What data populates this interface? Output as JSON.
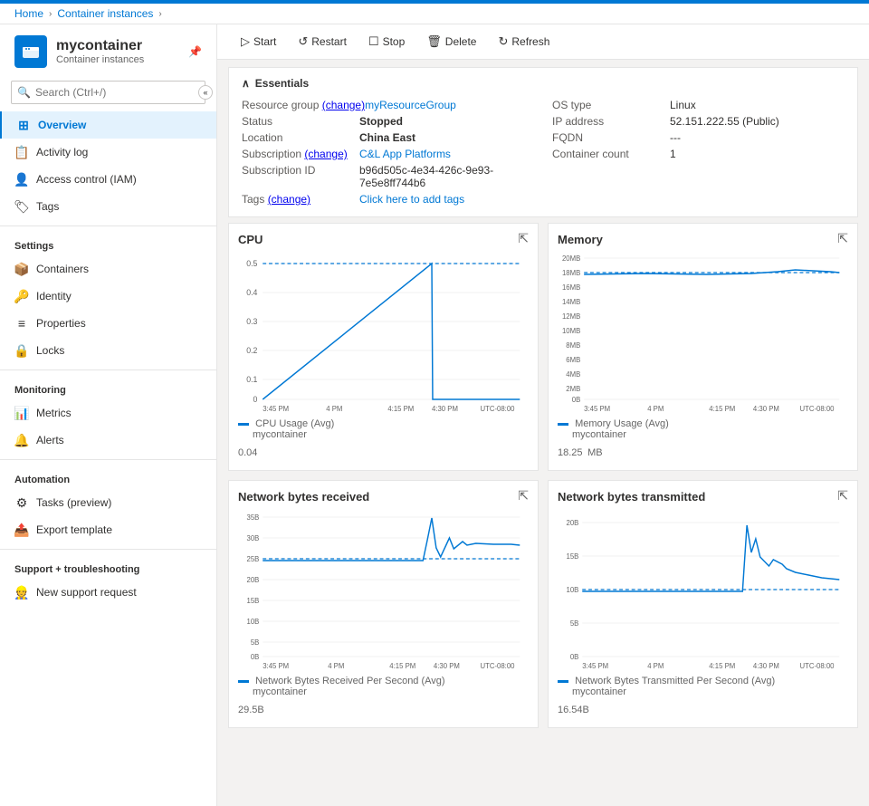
{
  "topBar": {
    "breadcrumbs": [
      "Home",
      "Container instances"
    ]
  },
  "sidebar": {
    "title": "mycontainer",
    "subtitle": "Container instances",
    "searchPlaceholder": "Search (Ctrl+/)",
    "nav": [
      {
        "id": "overview",
        "label": "Overview",
        "icon": "⊞",
        "active": true,
        "section": null
      },
      {
        "id": "activity-log",
        "label": "Activity log",
        "icon": "📋",
        "active": false,
        "section": null
      },
      {
        "id": "access-control",
        "label": "Access control (IAM)",
        "icon": "👤",
        "active": false,
        "section": null
      },
      {
        "id": "tags",
        "label": "Tags",
        "icon": "🏷",
        "active": false,
        "section": null
      },
      {
        "id": "settings-header",
        "label": "Settings",
        "section": true
      },
      {
        "id": "containers",
        "label": "Containers",
        "icon": "📦",
        "active": false,
        "section": false
      },
      {
        "id": "identity",
        "label": "Identity",
        "icon": "🔑",
        "active": false,
        "section": false
      },
      {
        "id": "properties",
        "label": "Properties",
        "icon": "≡",
        "active": false,
        "section": false
      },
      {
        "id": "locks",
        "label": "Locks",
        "icon": "🔒",
        "active": false,
        "section": false
      },
      {
        "id": "monitoring-header",
        "label": "Monitoring",
        "section": true
      },
      {
        "id": "metrics",
        "label": "Metrics",
        "icon": "📊",
        "active": false,
        "section": false
      },
      {
        "id": "alerts",
        "label": "Alerts",
        "icon": "🔔",
        "active": false,
        "section": false
      },
      {
        "id": "automation-header",
        "label": "Automation",
        "section": true
      },
      {
        "id": "tasks",
        "label": "Tasks (preview)",
        "icon": "⚙",
        "active": false,
        "section": false
      },
      {
        "id": "export-template",
        "label": "Export template",
        "icon": "📤",
        "active": false,
        "section": false
      },
      {
        "id": "support-header",
        "label": "Support + troubleshooting",
        "section": true
      },
      {
        "id": "new-support",
        "label": "New support request",
        "icon": "👷",
        "active": false,
        "section": false
      }
    ]
  },
  "toolbar": {
    "buttons": [
      {
        "id": "start",
        "label": "Start",
        "icon": "▷"
      },
      {
        "id": "restart",
        "label": "Restart",
        "icon": "↺"
      },
      {
        "id": "stop",
        "label": "Stop",
        "icon": "☐"
      },
      {
        "id": "delete",
        "label": "Delete",
        "icon": "🗑"
      },
      {
        "id": "refresh",
        "label": "Refresh",
        "icon": "↻"
      }
    ]
  },
  "essentials": {
    "header": "Essentials",
    "leftFields": [
      {
        "label": "Resource group (change)",
        "value": "myResourceGroup",
        "link": true
      },
      {
        "label": "Status",
        "value": "Stopped",
        "bold": true
      },
      {
        "label": "Location",
        "value": "China East",
        "bold": true
      },
      {
        "label": "Subscription (change)",
        "value": "C&L App Platforms",
        "link": true
      },
      {
        "label": "Subscription ID",
        "value": "b96d505c-4e34-426c-9e93-7e5e8ff744b6"
      },
      {
        "label": "Tags (change)",
        "value": "Click here to add tags",
        "link": true
      }
    ],
    "rightFields": [
      {
        "label": "OS type",
        "value": "Linux"
      },
      {
        "label": "IP address",
        "value": "52.151.222.55 (Public)"
      },
      {
        "label": "FQDN",
        "value": "---"
      },
      {
        "label": "Container count",
        "value": "1"
      }
    ]
  },
  "charts": {
    "cpu": {
      "title": "CPU",
      "legendLabel": "CPU Usage (Avg)",
      "legendSub": "mycontainer",
      "value": "0.04",
      "unit": "",
      "xLabels": [
        "3:45 PM",
        "4 PM",
        "4:15 PM",
        "4:30 PM",
        "UTC-08:00"
      ],
      "yLabels": [
        "0.5",
        "0.4",
        "0.3",
        "0.2",
        "0.1",
        "0"
      ],
      "color": "#0078d4"
    },
    "memory": {
      "title": "Memory",
      "legendLabel": "Memory Usage (Avg)",
      "legendSub": "mycontainer",
      "value": "18.25",
      "unit": "MB",
      "xLabels": [
        "3:45 PM",
        "4 PM",
        "4:15 PM",
        "4:30 PM",
        "UTC-08:00"
      ],
      "yLabels": [
        "20MB",
        "18MB",
        "16MB",
        "14MB",
        "12MB",
        "10MB",
        "8MB",
        "6MB",
        "4MB",
        "2MB",
        "0B"
      ],
      "color": "#0078d4"
    },
    "netReceived": {
      "title": "Network bytes received",
      "legendLabel": "Network Bytes Received Per Second (Avg)",
      "legendSub": "mycontainer",
      "value": "29.5",
      "unit": "B",
      "xLabels": [
        "3:45 PM",
        "4 PM",
        "4:15 PM",
        "4:30 PM",
        "UTC-08:00"
      ],
      "yLabels": [
        "35B",
        "30B",
        "25B",
        "20B",
        "15B",
        "10B",
        "5B",
        "0B"
      ],
      "color": "#0078d4"
    },
    "netTransmitted": {
      "title": "Network bytes transmitted",
      "legendLabel": "Network Bytes Transmitted Per Second (Avg)",
      "legendSub": "mycontainer",
      "value": "16.54",
      "unit": "B",
      "xLabels": [
        "3:45 PM",
        "4 PM",
        "4:15 PM",
        "4:30 PM",
        "UTC-08:00"
      ],
      "yLabels": [
        "20B",
        "15B",
        "10B",
        "5B",
        "0B"
      ],
      "color": "#0078d4"
    }
  }
}
